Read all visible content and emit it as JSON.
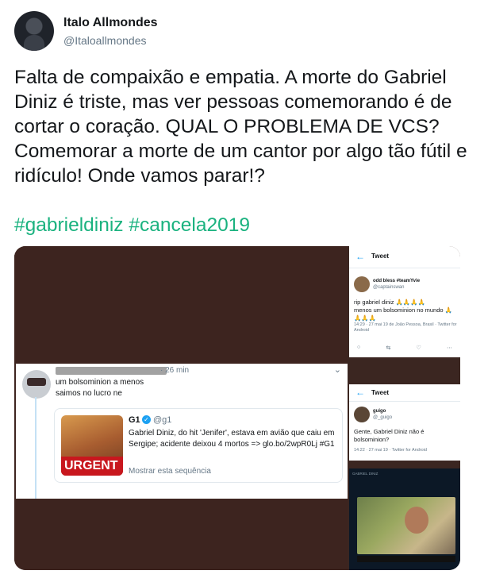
{
  "header": {
    "display_name": "Italo Allmondes",
    "handle": "@Italoallmondes"
  },
  "tweet": {
    "text": "Falta de compaixão e empatia. A morte do Gabriel Diniz é triste, mas ver pessoas comemorando é de cortar o coração. QUAL O PROBLEMA DE VCS?\nComemorar a morte de um cantor por algo tão fútil e ridículo! Onde vamos parar!?",
    "hashtags": [
      "#gabrieldiniz",
      "#cancela2019"
    ]
  },
  "embedded": {
    "time": "· 26 min",
    "line1": "um bolsominion a menos",
    "line2": "saimos no lucro ne",
    "card": {
      "author": "G1",
      "handle": "@g1",
      "text": "Gabriel Diniz, do hit 'Jenifer', estava em avião que caiu em Sergipe; acidente deixou 4 mortos => glo.bo/2wpR0Lj #G1",
      "link": "Mostrar esta sequência",
      "image_label": "URGENT"
    }
  },
  "panel1": {
    "title": "Tweet",
    "name": "odd bless #teamYvie",
    "handle": "@captainswan",
    "text": "rip gabriel diniz 🙏🙏🙏🙏\nmenos um bolsominion no mundo 🙏🙏🙏🙏",
    "meta": "14:29 · 27 mai 19 de João Pessoa, Brasil · Twitter for Android"
  },
  "panel2": {
    "title": "Tweet",
    "name": "guigo",
    "handle": "@_guigo",
    "text": "Gente, Gabriel Diniz não é bolsominion?",
    "meta": "14:22 · 27 mai 19 · Twitter for Android"
  },
  "panel3": {
    "header": "GABRIEL DINIZ"
  },
  "icons": {
    "back": "arrow-left-icon",
    "verified": "verified-badge-icon",
    "caret": "chevron-down-icon"
  }
}
